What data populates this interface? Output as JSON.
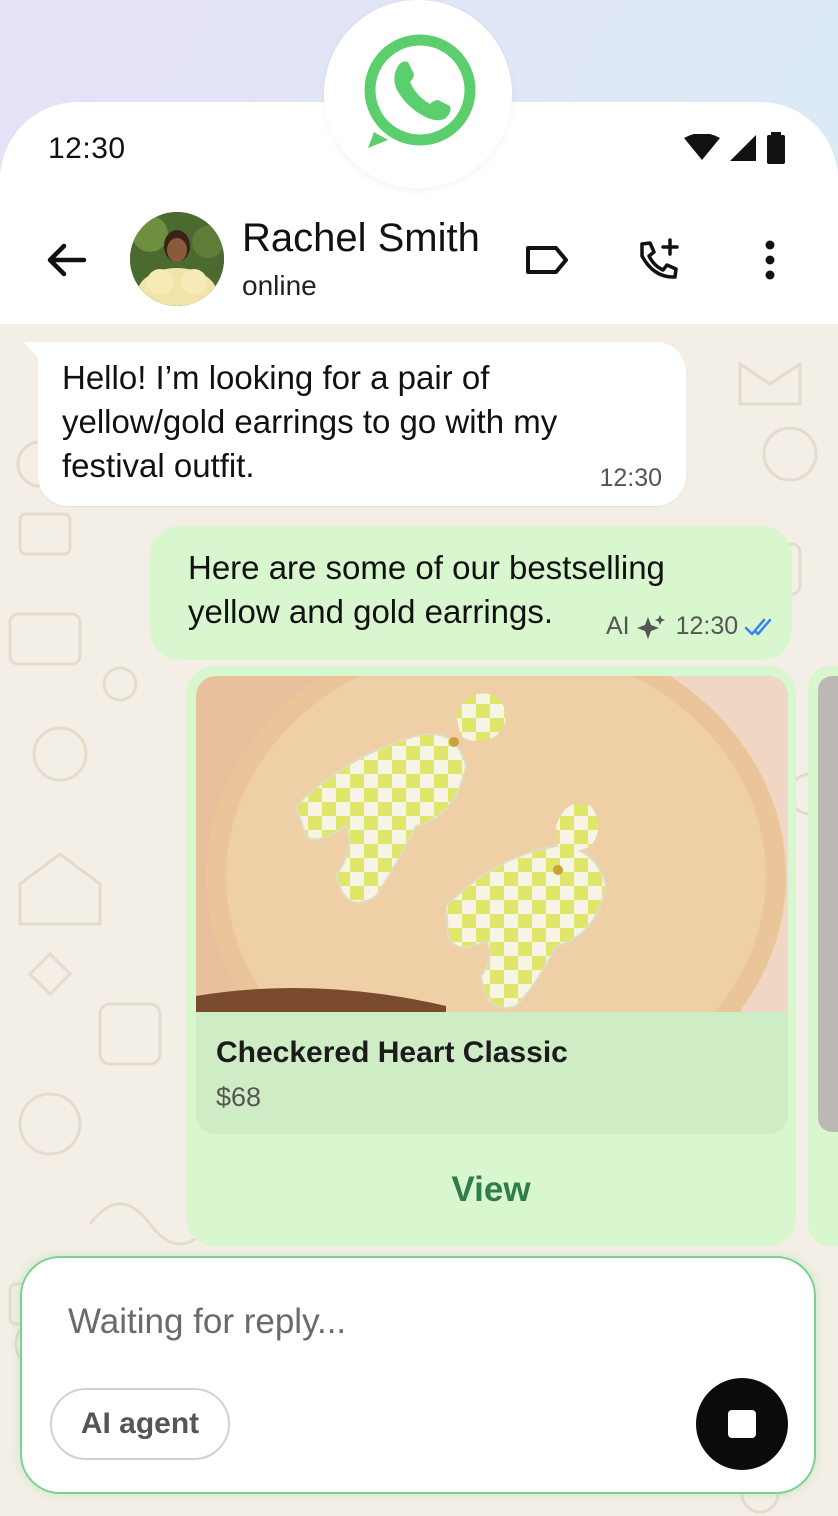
{
  "status_bar": {
    "time": "12:30"
  },
  "header": {
    "contact_name": "Rachel Smith",
    "contact_status": "online"
  },
  "messages": {
    "incoming": {
      "lines": [
        "Hello! I’m looking for a pair of",
        "yellow/gold earrings to go with my",
        "festival outfit."
      ],
      "time": "12:30"
    },
    "outgoing": {
      "lines": [
        "Here are some of our bestselling",
        "yellow and gold earrings."
      ],
      "ai_label": "AI",
      "time": "12:30"
    }
  },
  "product": {
    "name": "Checkered Heart Classic",
    "price": "$68",
    "action_label": "View"
  },
  "composer": {
    "placeholder": "Waiting for reply...",
    "chip_label": "AI agent"
  },
  "colors": {
    "whatsapp_green": "#5bcf6e",
    "outgoing_bubble": "#d9f7cf",
    "read_tick": "#3b82f6",
    "view_link": "#2f7d4b"
  }
}
